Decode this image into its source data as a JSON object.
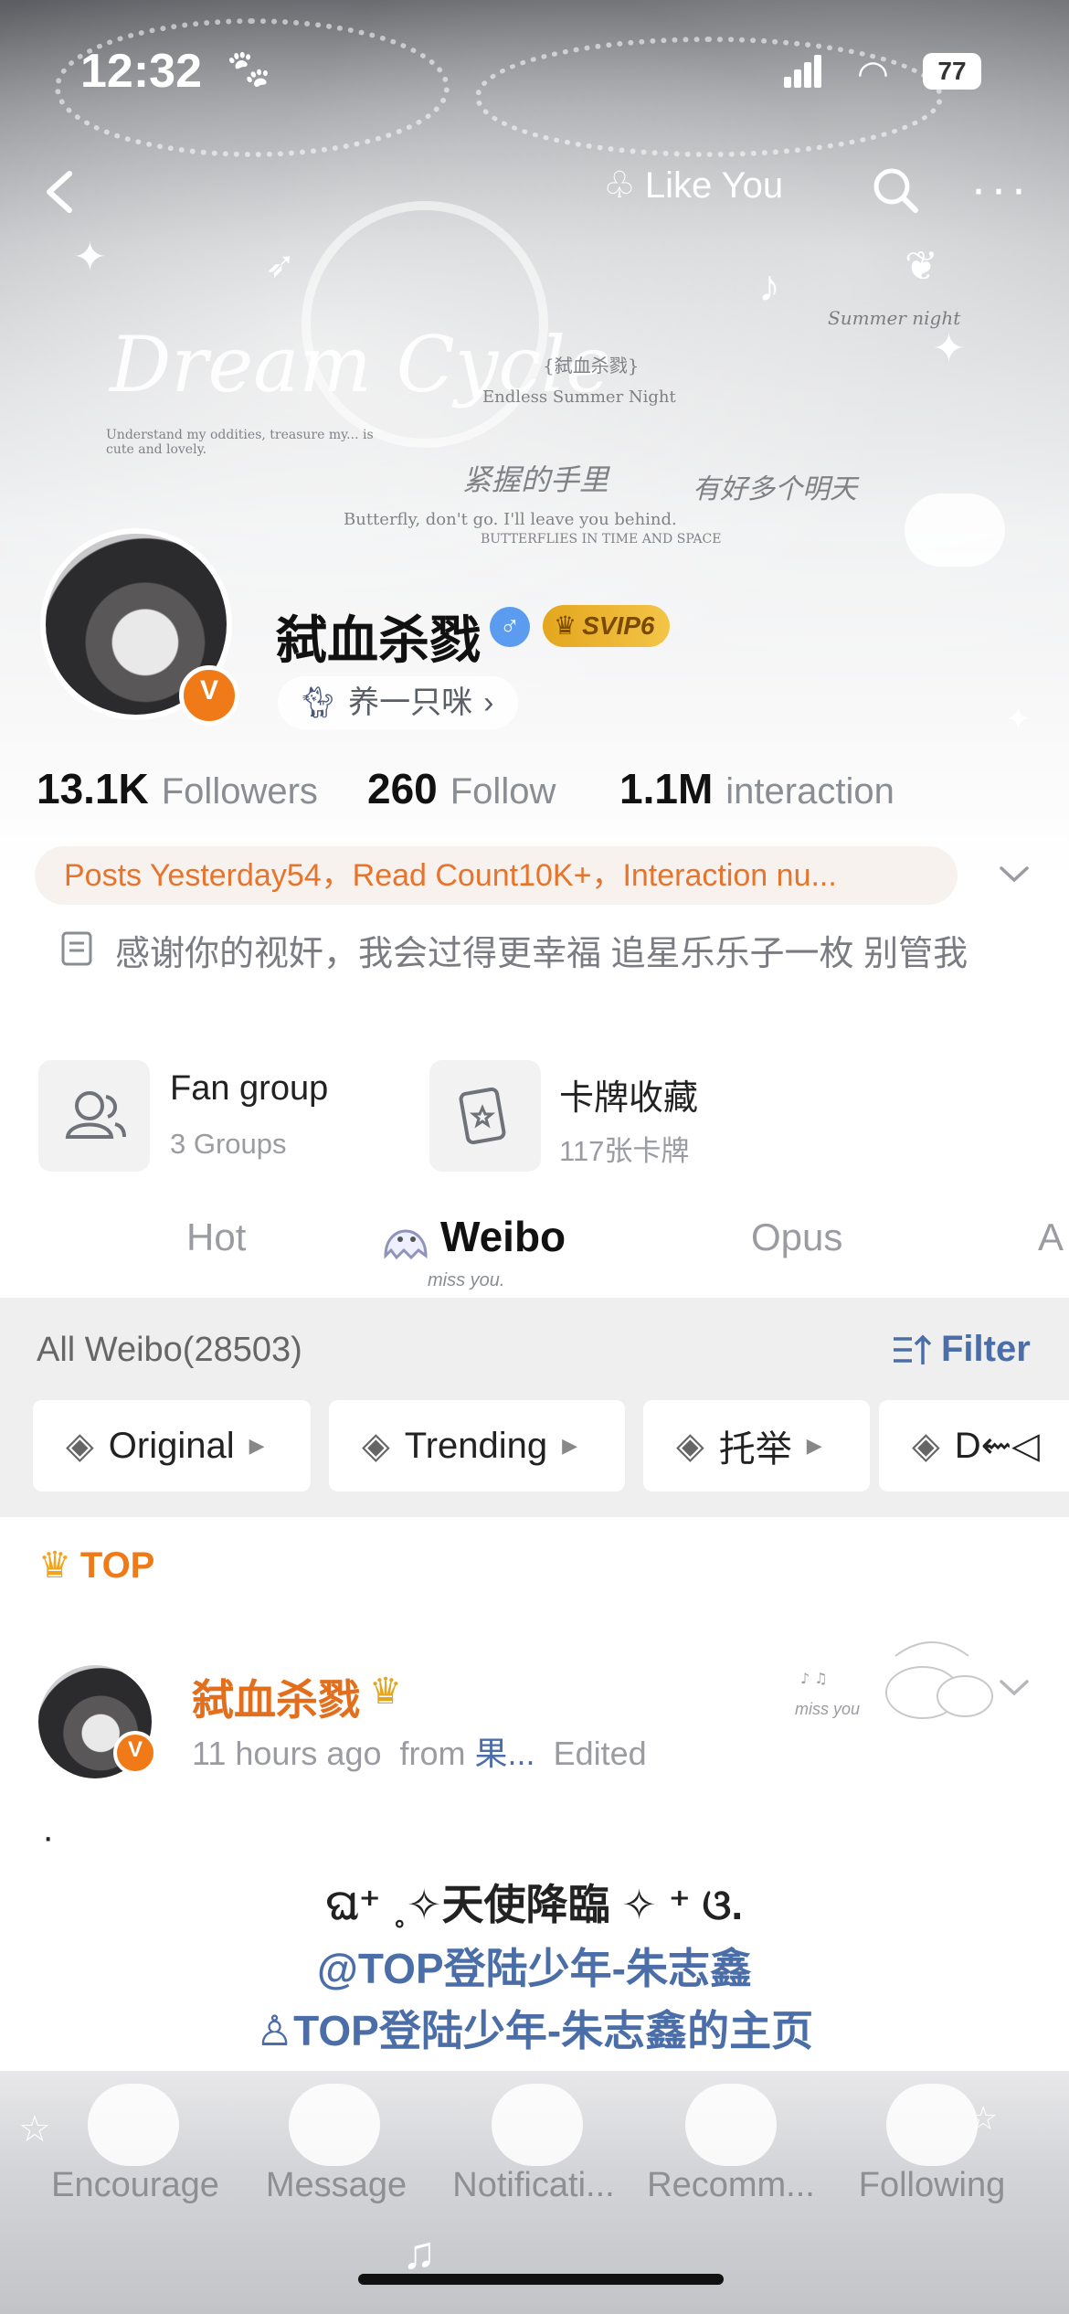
{
  "status_bar": {
    "time": "12:32",
    "battery": "77"
  },
  "top_nav": {
    "like_you": "Like You"
  },
  "banner_art": {
    "title": "Dream Cycle",
    "subtitle": "Endless Summer Night",
    "tag": "{弑血杀戮}",
    "small_line": "Understand my oddities, treasure my... is cute and lovely.",
    "handwriting_left": "紧握的手里",
    "handwriting_right": "有好多个明天",
    "butterfly_line": "Butterfly, don't go. I'll leave you behind.",
    "butterflies_line": "BUTTERFLIES IN TIME AND SPACE",
    "summer_night": "Summer night"
  },
  "profile": {
    "username": "弑血杀戮",
    "svip": "SVIP6",
    "pet_chip": "养一只咪",
    "stats": [
      {
        "value": "13.1K",
        "label": "Followers"
      },
      {
        "value": "260",
        "label": "Follow"
      },
      {
        "value": "1.1M",
        "label": "interaction"
      }
    ],
    "summary": "Posts Yesterday54，Read Count10K+，Interaction nu...",
    "bio": "感谢你的视奸，我会过得更幸福  追星乐乐子一枚 别管我"
  },
  "cards": [
    {
      "title": "Fan group",
      "sub": "3 Groups"
    },
    {
      "title": "卡牌收藏",
      "sub": "117张卡牌"
    }
  ],
  "tabs": {
    "hot": "Hot",
    "weibo": "Weibo",
    "opus": "Opus",
    "more": "A",
    "mascot_caption": "miss you."
  },
  "filter": {
    "all_weibo": "All Weibo(28503)",
    "filter_label": "Filter",
    "chips": [
      "Original",
      "Trending",
      "托举",
      "D⇜◁"
    ]
  },
  "post": {
    "top_label": "TOP",
    "author": "弑血杀戮",
    "time": "11 hours ago",
    "from": "from",
    "source": "果...",
    "edited": "Edited",
    "dot": "·",
    "line1": "ଘ⁺ ˳✧天使降臨 ✧ ⁺ ଓ.",
    "line2": "@TOP登陆少年-朱志鑫",
    "line3": "TOP登陆少年-朱志鑫的主页",
    "deco_caption": "miss you"
  },
  "bottom_nav": [
    "Encourage",
    "Message",
    "Notificati...",
    "Recomm...",
    "Following"
  ],
  "colors": {
    "accent_orange": "#f07a18",
    "link_blue": "#4b6ea8",
    "verified_blue": "#5b9cf0"
  }
}
